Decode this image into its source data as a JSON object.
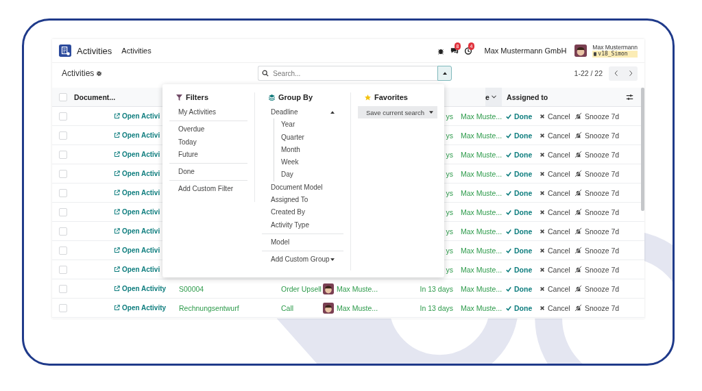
{
  "app": {
    "name": "Activities",
    "menu": [
      {
        "label": "Activities",
        "selected": false
      }
    ]
  },
  "systray": {
    "messages_badge": "8",
    "activities_badge": "4",
    "company": "Max Mustermann GmbH",
    "user": "Max Mustermann",
    "database": "v18_Simon"
  },
  "control_panel": {
    "title": "Activities",
    "search": {
      "placeholder": "Search..."
    },
    "search_panel_open": true,
    "pager": "1-22 / 22"
  },
  "table": {
    "header_checked": false,
    "columns": [
      {
        "label": "Document..."
      },
      {
        "label": "e"
      },
      {
        "label": "Assigned to"
      }
    ],
    "rows": [
      {
        "checked": false,
        "open": "Open Activi",
        "due": "ys",
        "assigned": "Max Muste...",
        "done": "Done",
        "cancel": "Cancel",
        "snooze": "Snooze 7d"
      },
      {
        "checked": false,
        "open": "Open Activi",
        "due": "ys",
        "assigned": "Max Muste...",
        "done": "Done",
        "cancel": "Cancel",
        "snooze": "Snooze 7d"
      },
      {
        "checked": false,
        "open": "Open Activi",
        "due": "ys",
        "assigned": "Max Muste...",
        "done": "Done",
        "cancel": "Cancel",
        "snooze": "Snooze 7d"
      },
      {
        "checked": false,
        "open": "Open Activi",
        "due": "ys",
        "assigned": "Max Muste...",
        "done": "Done",
        "cancel": "Cancel",
        "snooze": "Snooze 7d"
      },
      {
        "checked": false,
        "open": "Open Activi",
        "due": "ys",
        "assigned": "Max Muste...",
        "done": "Done",
        "cancel": "Cancel",
        "snooze": "Snooze 7d"
      },
      {
        "checked": false,
        "open": "Open Activi",
        "due": "ys",
        "assigned": "Max Muste...",
        "done": "Done",
        "cancel": "Cancel",
        "snooze": "Snooze 7d"
      },
      {
        "checked": false,
        "open": "Open Activi",
        "due": "ys",
        "assigned": "Max Muste...",
        "done": "Done",
        "cancel": "Cancel",
        "snooze": "Snooze 7d"
      },
      {
        "checked": false,
        "open": "Open Activi",
        "due": "ys",
        "assigned": "Max Muste...",
        "done": "Done",
        "cancel": "Cancel",
        "snooze": "Snooze 7d"
      },
      {
        "checked": false,
        "open": "Open Activi",
        "due": "ys",
        "assigned": "Max Muste...",
        "done": "Done",
        "cancel": "Cancel",
        "snooze": "Snooze 7d"
      },
      {
        "checked": false,
        "open": "Open Activity",
        "document": "S00004",
        "activity_type": "Order Upsell",
        "user": "Max Muste...",
        "due": "In 13 days",
        "assigned": "Max Muste...",
        "done": "Done",
        "cancel": "Cancel",
        "snooze": "Snooze 7d"
      },
      {
        "checked": false,
        "open": "Open Activity",
        "document": "Rechnungsentwurf",
        "activity_type": "Call",
        "user": "Max Muste...",
        "due": "In 13 days",
        "assigned": "Max Muste...",
        "done": "Done",
        "cancel": "Cancel",
        "snooze": "Snooze 7d"
      }
    ]
  },
  "search_panel": {
    "filters": {
      "title": "Filters",
      "groups": [
        {
          "items": [
            {
              "label": "My Activities",
              "selected": false
            }
          ]
        },
        {
          "items": [
            {
              "label": "Overdue",
              "selected": false
            },
            {
              "label": "Today",
              "selected": false
            },
            {
              "label": "Future",
              "selected": false
            }
          ]
        },
        {
          "items": [
            {
              "label": "Done",
              "selected": false
            }
          ]
        }
      ],
      "custom_filter": "Add Custom Filter"
    },
    "group_by": {
      "title": "Group By",
      "groups": [
        {
          "items": [
            {
              "label": "Deadline",
              "selected": false,
              "expanded": true,
              "children": [
                {
                  "label": "Year",
                  "selected": false
                },
                {
                  "label": "Quarter",
                  "selected": false
                },
                {
                  "label": "Month",
                  "selected": false
                },
                {
                  "label": "Week",
                  "selected": false
                },
                {
                  "label": "Day",
                  "selected": false
                }
              ]
            },
            {
              "label": "Document Model",
              "selected": false
            },
            {
              "label": "Assigned To",
              "selected": false
            },
            {
              "label": "Created By",
              "selected": false
            },
            {
              "label": "Activity Type",
              "selected": false
            }
          ]
        },
        {
          "items": [
            {
              "label": "Model",
              "selected": false
            }
          ]
        }
      ],
      "custom_group": "Add Custom Group"
    },
    "favorites": {
      "title": "Favorites",
      "save_search": "Save current search"
    }
  }
}
